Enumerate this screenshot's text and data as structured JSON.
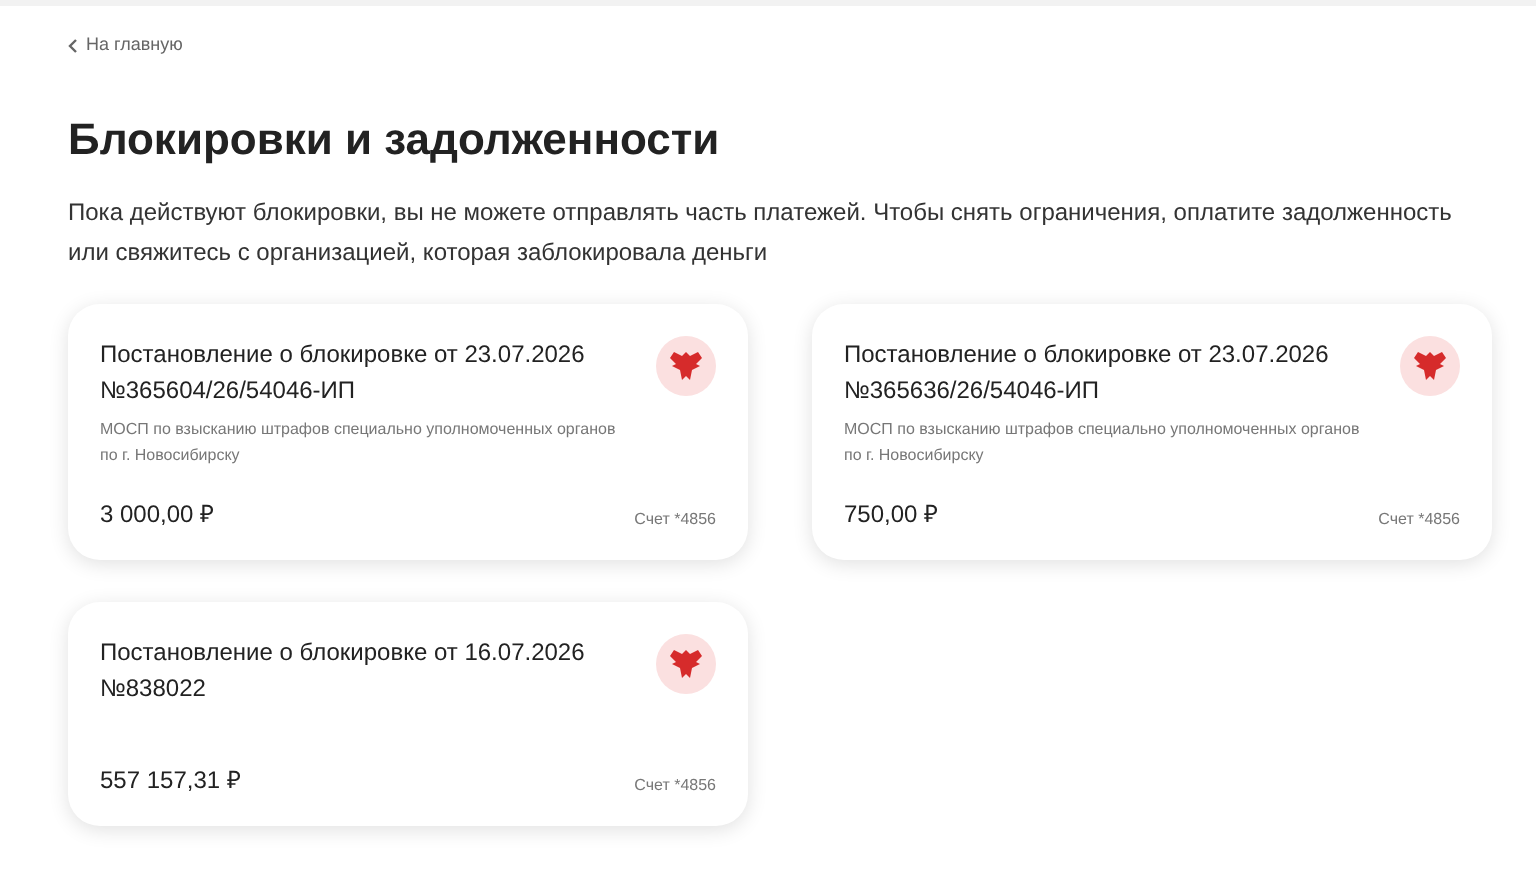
{
  "back_link": {
    "label": "На главную"
  },
  "heading": "Блокировки и задолженности",
  "description": "Пока действуют блокировки, вы не можете отправлять часть платежей. Чтобы снять ограничения, оплатите задолженность или свяжитесь с организацией, которая заблокировала деньги",
  "cards": [
    {
      "title": "Постановление о блокировке от 23.07.2026",
      "number": "№365604/26/54046-ИП",
      "organization": "МОСП по взысканию штрафов специально уполномоченных органов по г. Новосибирску",
      "amount": "3 000,00 ₽",
      "account": "Счет *4856"
    },
    {
      "title": "Постановление о блокировке от 23.07.2026",
      "number": "№365636/26/54046-ИП",
      "organization": "МОСП по взысканию штрафов специально уполномоченных органов по г. Новосибирску",
      "amount": "750,00 ₽",
      "account": "Счет *4856"
    },
    {
      "title": "Постановление о блокировке от 16.07.2026",
      "number": "№838022",
      "amount": "557 157,31 ₽",
      "account": "Счет *4856"
    }
  ]
}
